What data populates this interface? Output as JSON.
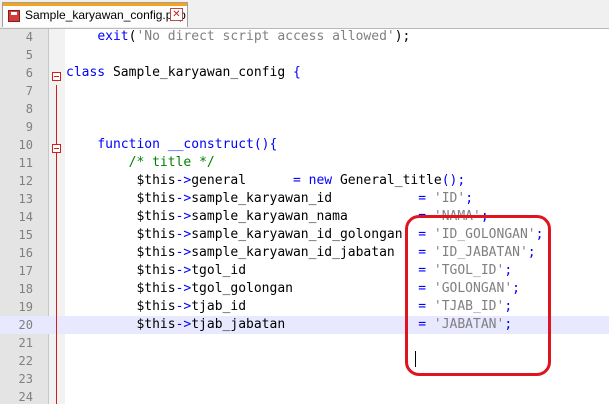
{
  "tab": {
    "filename": "Sample_karyawan_config.php",
    "close_glyph": "✕"
  },
  "colors": {
    "keyword": "#0000ff",
    "string": "#808080",
    "comment": "#008000",
    "highlight": "#e0141e",
    "current_line": "#e8e8ff"
  },
  "lines": [
    {
      "n": "4",
      "segments": [
        {
          "t": "    "
        },
        {
          "t": "exit",
          "c": "kw"
        },
        {
          "t": "("
        },
        {
          "t": "'No direct script access allowed'",
          "c": "str"
        },
        {
          "t": ");"
        }
      ]
    },
    {
      "n": "5",
      "segments": []
    },
    {
      "n": "6",
      "segments": [
        {
          "t": "class",
          "c": "kw"
        },
        {
          "t": " Sample_karyawan_config "
        },
        {
          "t": "{",
          "c": "kw"
        }
      ]
    },
    {
      "n": "7",
      "segments": []
    },
    {
      "n": "8",
      "segments": []
    },
    {
      "n": "9",
      "segments": []
    },
    {
      "n": "10",
      "segments": [
        {
          "t": "    "
        },
        {
          "t": "function",
          "c": "kw"
        },
        {
          "t": " "
        },
        {
          "t": "__construct",
          "c": "kw"
        },
        {
          "t": "(){",
          "c": "kw"
        }
      ]
    },
    {
      "n": "11",
      "segments": [
        {
          "t": "        "
        },
        {
          "t": "/* title */",
          "c": "cm"
        }
      ]
    },
    {
      "n": "12",
      "segments": [
        {
          "t": "         $this"
        },
        {
          "t": "->",
          "c": "kw"
        },
        {
          "t": "general      "
        },
        {
          "t": "= ",
          "c": "kw"
        },
        {
          "t": "new",
          "c": "kw"
        },
        {
          "t": " General_title"
        },
        {
          "t": "();",
          "c": "kw"
        }
      ]
    },
    {
      "n": "13",
      "segments": [
        {
          "t": "         $this"
        },
        {
          "t": "->",
          "c": "kw"
        },
        {
          "t": "sample_karyawan_id           "
        },
        {
          "t": "= ",
          "c": "kw"
        },
        {
          "t": "'ID'",
          "c": "str"
        },
        {
          "t": ";",
          "c": "kw"
        }
      ]
    },
    {
      "n": "14",
      "segments": [
        {
          "t": "         $this"
        },
        {
          "t": "->",
          "c": "kw"
        },
        {
          "t": "sample_karyawan_nama         "
        },
        {
          "t": "= ",
          "c": "kw"
        },
        {
          "t": "'NAMA'",
          "c": "str"
        },
        {
          "t": ";",
          "c": "kw"
        }
      ]
    },
    {
      "n": "15",
      "segments": [
        {
          "t": "         $this"
        },
        {
          "t": "->",
          "c": "kw"
        },
        {
          "t": "sample_karyawan_id_golongan  "
        },
        {
          "t": "= ",
          "c": "kw"
        },
        {
          "t": "'ID_GOLONGAN'",
          "c": "str"
        },
        {
          "t": ";",
          "c": "kw"
        }
      ]
    },
    {
      "n": "16",
      "segments": [
        {
          "t": "         $this"
        },
        {
          "t": "->",
          "c": "kw"
        },
        {
          "t": "sample_karyawan_id_jabatan   "
        },
        {
          "t": "= ",
          "c": "kw"
        },
        {
          "t": "'ID_JABATAN'",
          "c": "str"
        },
        {
          "t": ";",
          "c": "kw"
        }
      ]
    },
    {
      "n": "17",
      "segments": [
        {
          "t": "         $this"
        },
        {
          "t": "->",
          "c": "kw"
        },
        {
          "t": "tgol_id                      "
        },
        {
          "t": "= ",
          "c": "kw"
        },
        {
          "t": "'TGOL_ID'",
          "c": "str"
        },
        {
          "t": ";",
          "c": "kw"
        }
      ]
    },
    {
      "n": "18",
      "segments": [
        {
          "t": "         $this"
        },
        {
          "t": "->",
          "c": "kw"
        },
        {
          "t": "tgol_golongan                "
        },
        {
          "t": "= ",
          "c": "kw"
        },
        {
          "t": "'GOLONGAN'",
          "c": "str"
        },
        {
          "t": ";",
          "c": "kw"
        }
      ]
    },
    {
      "n": "19",
      "segments": [
        {
          "t": "         $this"
        },
        {
          "t": "->",
          "c": "kw"
        },
        {
          "t": "tjab_id                      "
        },
        {
          "t": "= ",
          "c": "kw"
        },
        {
          "t": "'TJAB_ID'",
          "c": "str"
        },
        {
          "t": ";",
          "c": "kw"
        }
      ]
    },
    {
      "n": "20",
      "current": true,
      "segments": [
        {
          "t": "         $this"
        },
        {
          "t": "->",
          "c": "kw"
        },
        {
          "t": "tjab_jabatan                 "
        },
        {
          "t": "= ",
          "c": "kw"
        },
        {
          "t": "'JABATAN'",
          "c": "str"
        },
        {
          "t": ";",
          "c": "kw"
        }
      ]
    },
    {
      "n": "21",
      "segments": []
    },
    {
      "n": "22",
      "segments": []
    },
    {
      "n": "23",
      "segments": []
    },
    {
      "n": "24",
      "segments": []
    }
  ]
}
